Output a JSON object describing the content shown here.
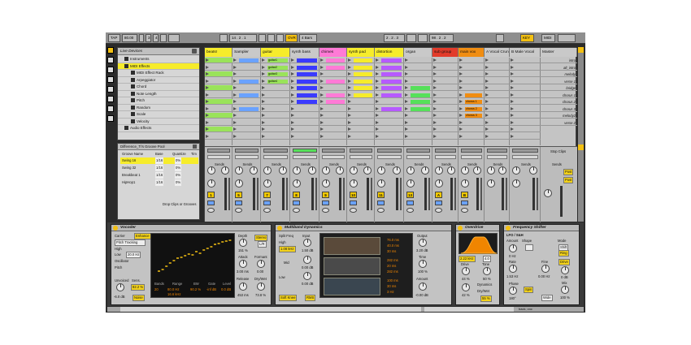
{
  "transport": {
    "tap": "TAP",
    "tempo": "80.00",
    "sig_num": "3",
    "sig_den": "4",
    "position": "14 . 2 . 1",
    "ovr": "OVR",
    "quantize": "4 Bars",
    "loop_pos": "2 . 2 . 3",
    "loop_len": "98 . 2 . 2",
    "key": "KEY",
    "midi": "MIDI"
  },
  "browser": {
    "title": "Live Devices",
    "items": [
      "Instruments",
      "MIDI Effects",
      "MIDI Effect Rack",
      "Arpeggiator",
      "Chord",
      "Note Length",
      "Pitch",
      "Random",
      "Scale",
      "Velocity",
      "Audio Effects"
    ]
  },
  "groove": {
    "title": "Difference_Ti's Groove Pool",
    "headers": [
      "Groove Name",
      "Base",
      "Quantize",
      "Tim"
    ],
    "rows": [
      {
        "name": "Swing 16",
        "base": "1/16",
        "q": "0%"
      },
      {
        "name": "Swing 32",
        "base": "1/16",
        "q": "0%"
      },
      {
        "name": "Breakbeat 1",
        "base": "1/16",
        "q": "0%"
      },
      {
        "name": "HipHop1",
        "base": "1/16",
        "q": "0%"
      }
    ],
    "drop_hint": "Drop Clips or Grooves"
  },
  "tracks": [
    {
      "name": "beats!",
      "color": "#f6ec2b"
    },
    {
      "name": "Sampler",
      "color": "#c9c9c9"
    },
    {
      "name": "guitar",
      "color": "#f6ec2b"
    },
    {
      "name": "synth bass",
      "color": "#c9c9c9"
    },
    {
      "name": "chimes",
      "color": "#ff7ad6"
    },
    {
      "name": "synth pad",
      "color": "#f6ec2b"
    },
    {
      "name": "distortion",
      "color": "#f6ec2b"
    },
    {
      "name": "organ",
      "color": "#c9c9c9"
    },
    {
      "name": "sub group",
      "color": "#e23b2a"
    },
    {
      "name": "main vox",
      "color": "#f08d12"
    },
    {
      "name": "A Vocal Crun",
      "color": "#c9c9c9"
    },
    {
      "name": "B Male Vocal",
      "color": "#c9c9c9"
    },
    {
      "name": "Master",
      "color": "#c9c9c9"
    }
  ],
  "clips": {
    "guitar": [
      "guitar1",
      "guitar2",
      "guitar3",
      "guitar4"
    ],
    "vox": [
      "chorus 1",
      "chorus 2",
      "chorus 3"
    ]
  },
  "scenes": [
    "intro",
    "alt_intro",
    "melody",
    "verse 1",
    "bridge",
    "chorus 1",
    "chorus 2",
    "chorus 3",
    "melody2",
    "verse 2"
  ],
  "mixer": {
    "sends": "Sends",
    "stop_clips": "Stop Clips",
    "post": "Post",
    "track_numbers": [
      "1",
      "5",
      "7",
      "8",
      "9",
      "10",
      "11",
      "13",
      "A",
      "B"
    ]
  },
  "vocoder": {
    "title": "Vocoder",
    "carrier": "Carrier",
    "enhance": "Enhance",
    "pitch_tracking": "Pitch Tracking",
    "high": "High",
    "low": "Low",
    "low_val": "20.0 Hz",
    "oscillator": "Oscillator",
    "pitch": "Pitch",
    "unvoiced": "Unvoiced",
    "sens": "Sens.",
    "unvoiced_val": "-6.0 dB",
    "sens_val": "82.2 %",
    "noise": "Noise",
    "bands": "Bands",
    "range": "Range",
    "bw": "BW",
    "gate": "Gate",
    "level": "Level",
    "bands_val": "20",
    "range_val1": "80.0 Hz",
    "range_val2": "16.6 kHz",
    "bw_val": "90.2 %",
    "gate_val": "-inf dB",
    "level_val": "0.0 dB",
    "depth": "Depth",
    "depth_val": "151 %",
    "stereo": "Stereo",
    "lr": "L/R",
    "attack": "Attack",
    "attack_val": "3.00 ms",
    "formant": "Formant",
    "formant_val": "0.00",
    "release": "Release",
    "release_val": "453 ms",
    "drywet": "Dry/Wet",
    "drywet_val": "73.8 %"
  },
  "multiband": {
    "title": "Multiband Dynamics",
    "split_freq": "Split Freq",
    "split_val": "1.08 kHz",
    "high": "High",
    "input": "Input",
    "input_val": "1.50 dB",
    "mid": "Mid",
    "mid_val": "0.00 dB",
    "low": "Low",
    "low_val": "0.00 dB",
    "soft_knee": "Soft Knee",
    "rms": "RMS",
    "output": "Output",
    "time": "Time",
    "amount": "Amount",
    "out1": "3.20 dB",
    "out2": "100 %",
    "out3": "-0.00 dB",
    "readouts": [
      "76.0 ms",
      "40.0 ms",
      "30 ms",
      "282 ms",
      "20 ms",
      "282 ms",
      "100 ms",
      "30 ms",
      "3 Hz"
    ]
  },
  "overdrive": {
    "title": "Overdrive",
    "freq": "2.22 kHz",
    "width": "4.0",
    "drive": "Drive",
    "drive_val": "44 %",
    "tone": "Tone",
    "tone_val": "50 %",
    "dynamics": "Dynamics",
    "dynamics_val": "42 %",
    "drywet": "Dry/Wet",
    "drywet_val": "55 %"
  },
  "freqshifter": {
    "title": "Frequency Shifter",
    "lfo": "LFO / S&H",
    "amount": "Amount",
    "shape": "Shape",
    "mode": "Mode",
    "shift": "Shift",
    "ring": "Ring",
    "rate": "Rate",
    "rate_val": "1.53 Hz",
    "fine": "Fine",
    "drive": "Drive",
    "phase": "Phase",
    "phase_val": "180°",
    "spin": "Spin",
    "mix": "Mix",
    "mix_val": "100 %",
    "wide": "Wide",
    "coarse": "0 Hz",
    "fine_val": "0.00 Hz",
    "drive_val": "0 dB"
  },
  "status": {
    "right": "back, voc"
  }
}
